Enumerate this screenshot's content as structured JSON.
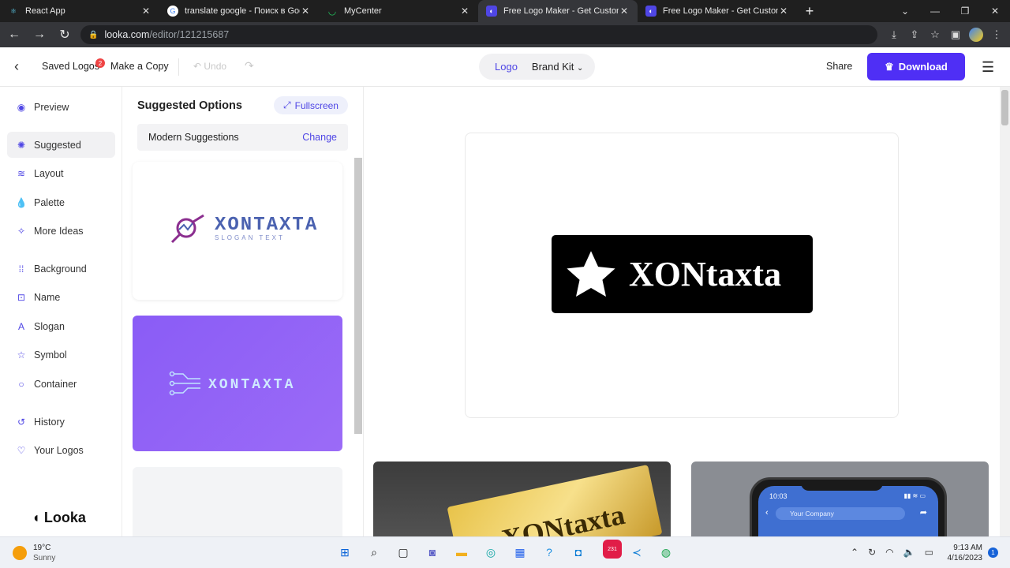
{
  "browser": {
    "tabs": [
      {
        "title": "React App",
        "favicon": "react-icon",
        "color": "#61dafb"
      },
      {
        "title": "translate google - Поиск в Google",
        "favicon": "google-icon",
        "color": "#4285f4"
      },
      {
        "title": "MyCenter",
        "favicon": "mycenter-icon",
        "color": "#22c55e"
      },
      {
        "title": "Free Logo Maker - Get Custom Logo",
        "favicon": "looka-icon",
        "color": "#4f46e5"
      },
      {
        "title": "Free Logo Maker - Get Custom Logo",
        "favicon": "looka-icon",
        "color": "#4f46e5"
      }
    ],
    "new_tab": "+",
    "url_host": "looka.com",
    "url_path": "/editor/121215687"
  },
  "header": {
    "saved_logos": "Saved Logos",
    "saved_count": "2",
    "make_copy": "Make a Copy",
    "undo": "Undo",
    "toggle_logo": "Logo",
    "toggle_brandkit": "Brand Kit",
    "share": "Share",
    "download": "Download"
  },
  "sidebar": {
    "items": [
      {
        "label": "Preview",
        "icon": "eye-icon"
      },
      {
        "label": "Suggested",
        "icon": "sparkle-icon"
      },
      {
        "label": "Layout",
        "icon": "layers-icon"
      },
      {
        "label": "Palette",
        "icon": "drop-icon"
      },
      {
        "label": "More Ideas",
        "icon": "wand-icon"
      },
      {
        "label": "Background",
        "icon": "grid-icon"
      },
      {
        "label": "Name",
        "icon": "text-box-icon"
      },
      {
        "label": "Slogan",
        "icon": "slogan-icon"
      },
      {
        "label": "Symbol",
        "icon": "star-icon"
      },
      {
        "label": "Container",
        "icon": "circle-icon"
      },
      {
        "label": "History",
        "icon": "history-icon"
      },
      {
        "label": "Your Logos",
        "icon": "heart-icon"
      }
    ],
    "brand": "Looka"
  },
  "panel": {
    "title": "Suggested Options",
    "fullscreen": "Fullscreen",
    "modern_label": "Modern Suggestions",
    "change": "Change",
    "card1_name": "XONTAXTA",
    "card1_slogan": "SLOGAN TEXT",
    "card2_name": "XONTAXTA"
  },
  "canvas": {
    "logo_text": "XONtaxta",
    "mockup_gold_text": "XONtaxta",
    "phone_time": "10:03",
    "phone_search": "Your Company"
  },
  "taskbar": {
    "temperature": "19°C",
    "weather": "Sunny",
    "time": "9:13 AM",
    "date": "4/16/2023",
    "notifications": "1",
    "telegram_badge": "231"
  }
}
